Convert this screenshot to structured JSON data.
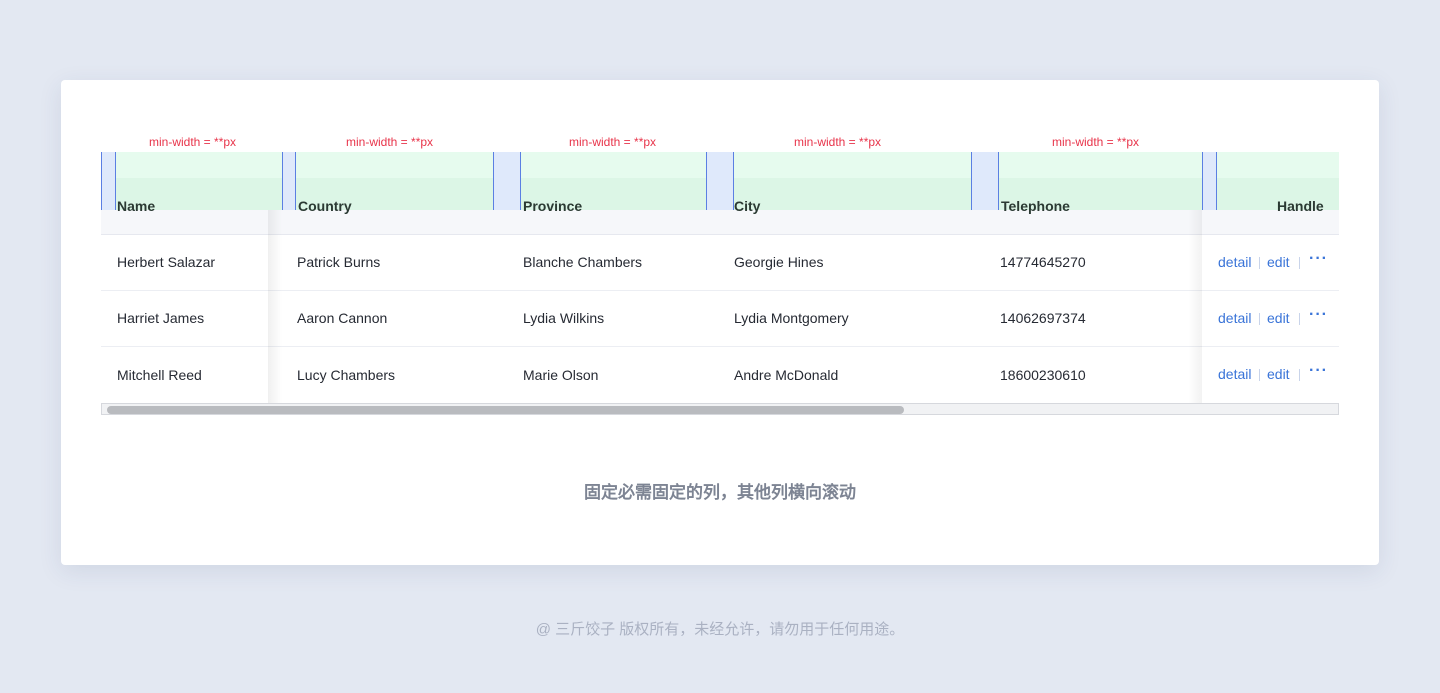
{
  "min_width_label": "min-width = **px",
  "columns": [
    "Name",
    "Country",
    "Province",
    "City",
    "Telephone",
    "Handle"
  ],
  "rows": [
    [
      "Herbert Salazar",
      "Patrick Burns",
      "Blanche Chambers",
      "Georgie Hines",
      "14774645270"
    ],
    [
      "Harriet James",
      "Aaron Cannon",
      "Lydia Wilkins",
      "Lydia Montgomery",
      "14062697374"
    ],
    [
      "Mitchell Reed",
      "Lucy Chambers",
      "Marie Olson",
      "Andre McDonald",
      "18600230610"
    ]
  ],
  "actions": {
    "detail": "detail",
    "edit": "edit",
    "more": "···"
  },
  "scrollbar": {
    "thumb_fraction": 0.65
  },
  "caption": "固定必需固定的列，其他列横向滚动",
  "copyright": "@ 三斤饺子   版权所有，未经允许，请勿用于任何用途。",
  "colors": {
    "background": "#e3e8f2",
    "header_green": "#dcf6e6",
    "annotation_red": "#e8344a",
    "link_blue": "#3a74d8"
  }
}
